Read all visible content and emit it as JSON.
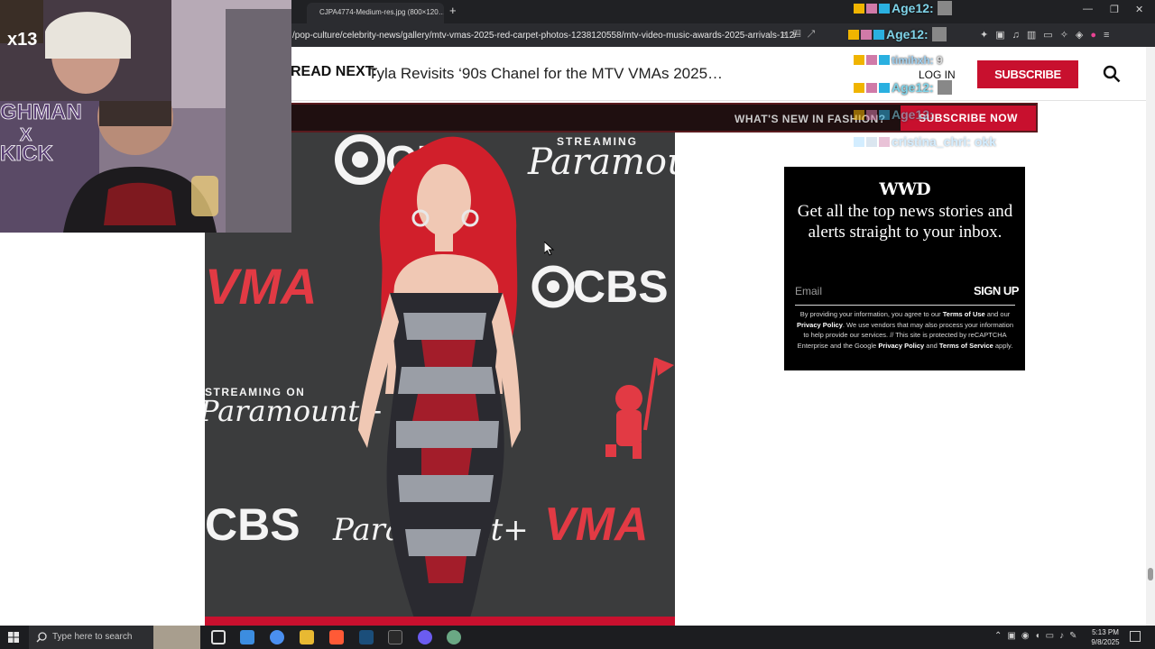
{
  "browser": {
    "tab_title": "CJPA4774-Medium-res.jpg (800×120…",
    "new_tab_symbol": "+",
    "url": "/pop-culture/celebrity-news/gallery/mtv-vmas-2025-red-carpet-photos-1238120558/mtv-video-music-awards-2025-arrivals-112/"
  },
  "site": {
    "read_next_label": "READ NEXT:",
    "read_next_title": "Tyla Revisits ‘90s Chanel for the MTV VMAs 2025…",
    "login": "LOG IN",
    "subscribe": "SUBSCRIBE",
    "promo_text": "WHAT'S NEW IN FASHION?",
    "promo_button": "SUBSCRIBE NOW",
    "accent_color": "#c8102e"
  },
  "photo": {
    "brands": [
      "CBS",
      "STREAMING",
      "Paramount",
      "VMA",
      "STREAMING ON",
      "Paramount+",
      "CBS",
      "CBS",
      "Paramount+",
      "VMA"
    ]
  },
  "newsletter": {
    "logo": "WWD",
    "title": "Get all the top news stories and alerts straight to your inbox.",
    "email_placeholder": "Email",
    "signup": "SIGN UP",
    "legal_1": "By providing your information, you agree to our ",
    "terms": "Terms of Use",
    "legal_2": " and our ",
    "privacy": "Privacy Policy",
    "legal_3": ". We use vendors that may also process your information to help provide our services. // This site is protected by reCAPTCHA Enterprise and the Google ",
    "privacy2": "Privacy Policy",
    "legal_4": " and ",
    "tos": "Terms of Service",
    "legal_5": " apply."
  },
  "overlay": {
    "cam_badge": "x13",
    "cam_text_1": "GHMAN",
    "cam_text_2": "X",
    "cam_text_3": "KICK",
    "chat": [
      {
        "user": "Age12:"
      },
      {
        "user": "Age12:"
      },
      {
        "user": "timihxh:",
        "msg": "9"
      },
      {
        "user": "Age12:"
      },
      {
        "user": "Age12:"
      },
      {
        "user": "cristina_chri:",
        "msg": "okk"
      }
    ]
  },
  "taskbar": {
    "search_placeholder": "Type here to search",
    "time": "5:13 PM",
    "date": "9/8/2025"
  }
}
